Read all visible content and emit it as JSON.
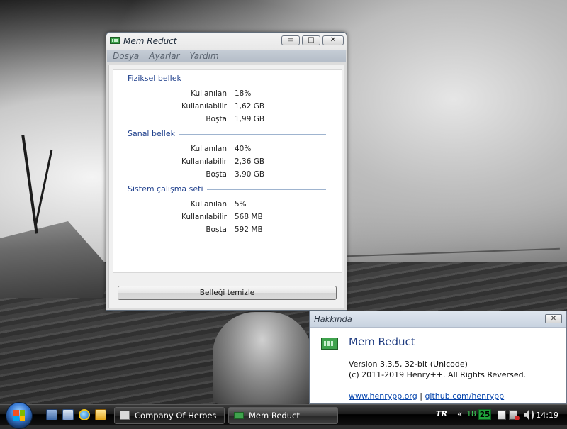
{
  "window": {
    "title": "Mem Reduct",
    "menu": [
      "Dosya",
      "Ayarlar",
      "Yardım"
    ],
    "caption_buttons": {
      "minimize": "▭",
      "maximize": "□",
      "close": "✕"
    }
  },
  "groups": [
    {
      "title": "Fiziksel bellek",
      "rows": [
        {
          "label": "Kullanılan",
          "value": "18%"
        },
        {
          "label": "Kullanılabilir",
          "value": "1,62 GB"
        },
        {
          "label": "Boşta",
          "value": "1,99 GB"
        }
      ]
    },
    {
      "title": "Sanal bellek",
      "rows": [
        {
          "label": "Kullanılan",
          "value": "40%"
        },
        {
          "label": "Kullanılabilir",
          "value": "2,36 GB"
        },
        {
          "label": "Boşta",
          "value": "3,90 GB"
        }
      ]
    },
    {
      "title": "Sistem çalışma seti",
      "rows": [
        {
          "label": "Kullanılan",
          "value": "5%"
        },
        {
          "label": "Kullanılabilir",
          "value": "568 MB"
        },
        {
          "label": "Boşta",
          "value": "592 MB"
        }
      ]
    }
  ],
  "clean_button_label": "Belleği temizle",
  "about": {
    "header": "Hakkında",
    "close_glyph": "✕",
    "app_name": "Mem Reduct",
    "version": "Version 3.3.5, 32-bit (Unicode)",
    "copyright": "(c) 2011-2019 Henry++. All Rights Reversed.",
    "link1": "www.henrypp.org",
    "separator": "|",
    "link2": "github.com/henrypp"
  },
  "taskbar": {
    "tasks": [
      {
        "label": "Company Of Heroes",
        "icon": "coh-icon"
      },
      {
        "label": "Mem Reduct",
        "icon": "memreduct-icon"
      }
    ],
    "language": "TR",
    "tray_arrow": "«",
    "tray_numbers": [
      "18",
      "25"
    ],
    "time": "14:19"
  },
  "colors": {
    "group_title": "#1e3f8c",
    "link": "#0645ad",
    "app_green": "#3fa34d",
    "tray_green": "#1fa33a"
  }
}
